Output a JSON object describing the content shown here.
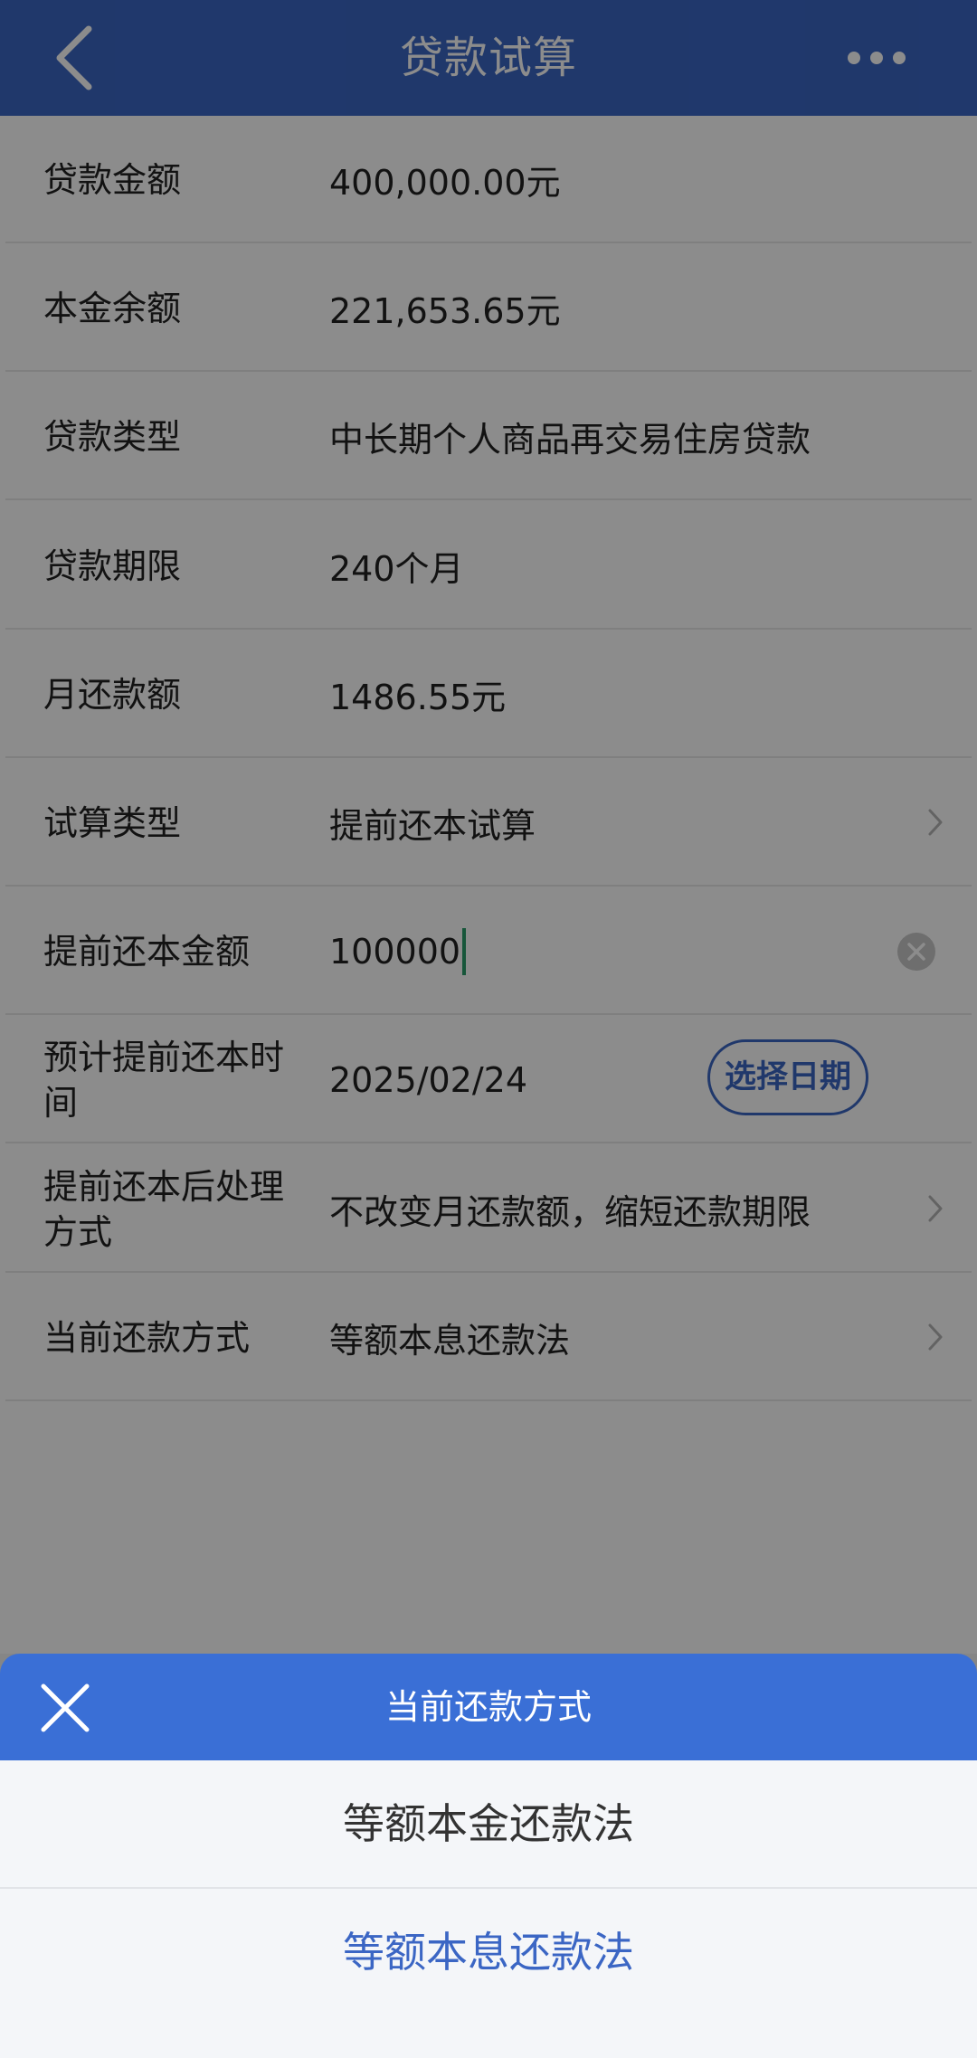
{
  "header": {
    "title": "贷款试算",
    "back_icon": "chevron-left-icon",
    "more_icon": "more-dots-icon"
  },
  "rows": [
    {
      "label": "贷款金额",
      "value": "400,000.00元"
    },
    {
      "label": "本金余额",
      "value": "221,653.65元"
    },
    {
      "label": "贷款类型",
      "value": "中长期个人商品再交易住房贷款"
    },
    {
      "label": "贷款期限",
      "value": "240个月"
    },
    {
      "label": "月还款额",
      "value": "1486.55元"
    },
    {
      "label": "试算类型",
      "value": "提前还本试算"
    },
    {
      "label": "提前还本金额",
      "value": "100000"
    },
    {
      "label": "预计提前还本时间",
      "value": "2025/02/24",
      "button": "选择日期"
    },
    {
      "label": "提前还本后处理方式",
      "value": "不改变月还款额，缩短还款期限"
    },
    {
      "label": "当前还款方式",
      "value": "等额本息还款法"
    }
  ],
  "sheet": {
    "title": "当前还款方式",
    "close_icon": "close-icon",
    "options": [
      {
        "label": "等额本金还款法",
        "selected": false
      },
      {
        "label": "等额本息还款法",
        "selected": true
      }
    ]
  },
  "colors": {
    "primary": "#3b66c4",
    "sheet_header": "#3a6fd6",
    "caret": "#2a9d6b"
  }
}
